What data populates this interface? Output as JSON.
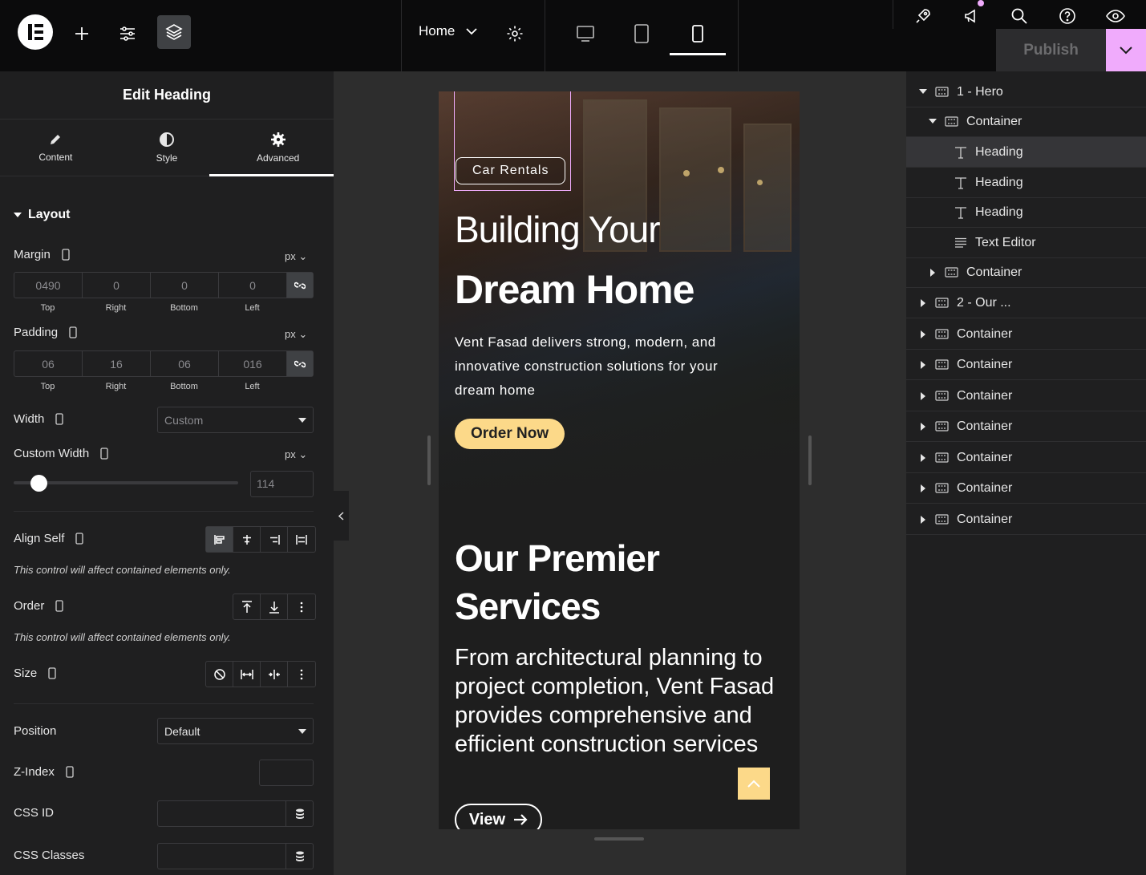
{
  "topbar": {
    "page_name": "Home",
    "publish_label": "Publish",
    "colors": {
      "accent": "#f0abfc",
      "bg": "#0b0b0c"
    }
  },
  "panel": {
    "title": "Edit Heading",
    "tabs": [
      {
        "label": "Content",
        "icon": "pencil-icon"
      },
      {
        "label": "Style",
        "icon": "half-circle-icon"
      },
      {
        "label": "Advanced",
        "icon": "gear-icon",
        "active": true
      }
    ],
    "section": "Layout",
    "margin": {
      "label": "Margin",
      "unit": "px",
      "values": [
        "0490",
        "0",
        "0",
        "0"
      ],
      "sides": [
        "Top",
        "Right",
        "Bottom",
        "Left"
      ]
    },
    "padding": {
      "label": "Padding",
      "unit": "px",
      "values": [
        "06",
        "16",
        "06",
        "016"
      ],
      "sides": [
        "Top",
        "Right",
        "Bottom",
        "Left"
      ]
    },
    "width": {
      "label": "Width",
      "value": "Custom"
    },
    "custom_width": {
      "label": "Custom Width",
      "unit": "px",
      "value": "114"
    },
    "align_self": {
      "label": "Align Self",
      "hint": "This control will affect contained elements only."
    },
    "order": {
      "label": "Order",
      "hint": "This control will affect contained elements only."
    },
    "size": {
      "label": "Size"
    },
    "position": {
      "label": "Position",
      "value": "Default"
    },
    "z_index": {
      "label": "Z-Index",
      "value": ""
    },
    "css_id": {
      "label": "CSS ID",
      "value": ""
    },
    "css_classes": {
      "label": "CSS Classes",
      "value": ""
    }
  },
  "canvas": {
    "chip": "Car Rentals",
    "heading_light": "Building Your",
    "heading_bold": "Dream Home",
    "paragraph": "Vent Fasad delivers strong, modern, and innovative construction solutions for your dream home",
    "order_btn": "Order Now",
    "services_heading": "Our Premier Services",
    "services_paragraph": "From architectural planning to project completion, Vent Fasad provides comprehensive and efficient construction services",
    "view_btn": "View",
    "colors": {
      "button": "#fcd989"
    }
  },
  "navigator": {
    "items": [
      {
        "label": "1 - Hero",
        "depth": 0,
        "caret": "down",
        "icon": "container-icon"
      },
      {
        "label": "Container",
        "depth": 1,
        "caret": "down",
        "icon": "container-icon"
      },
      {
        "label": "Heading",
        "depth": 2,
        "caret": "",
        "icon": "heading-icon",
        "selected": true
      },
      {
        "label": "Heading",
        "depth": 2,
        "caret": "",
        "icon": "heading-icon"
      },
      {
        "label": "Heading",
        "depth": 2,
        "caret": "",
        "icon": "heading-icon"
      },
      {
        "label": "Text Editor",
        "depth": 2,
        "caret": "",
        "icon": "text-editor-icon"
      },
      {
        "label": "Container",
        "depth": 1,
        "caret": "right",
        "icon": "container-icon"
      },
      {
        "label": "2 - Our ...",
        "depth": 0,
        "caret": "right",
        "icon": "container-icon"
      },
      {
        "label": "Container",
        "depth": 0,
        "caret": "right",
        "icon": "container-icon"
      },
      {
        "label": "Container",
        "depth": 0,
        "caret": "right",
        "icon": "container-icon"
      },
      {
        "label": "Container",
        "depth": 0,
        "caret": "right",
        "icon": "container-icon"
      },
      {
        "label": "Container",
        "depth": 0,
        "caret": "right",
        "icon": "container-icon"
      },
      {
        "label": "Container",
        "depth": 0,
        "caret": "right",
        "icon": "container-icon"
      },
      {
        "label": "Container",
        "depth": 0,
        "caret": "right",
        "icon": "container-icon"
      },
      {
        "label": "Container",
        "depth": 0,
        "caret": "right",
        "icon": "container-icon"
      }
    ]
  }
}
